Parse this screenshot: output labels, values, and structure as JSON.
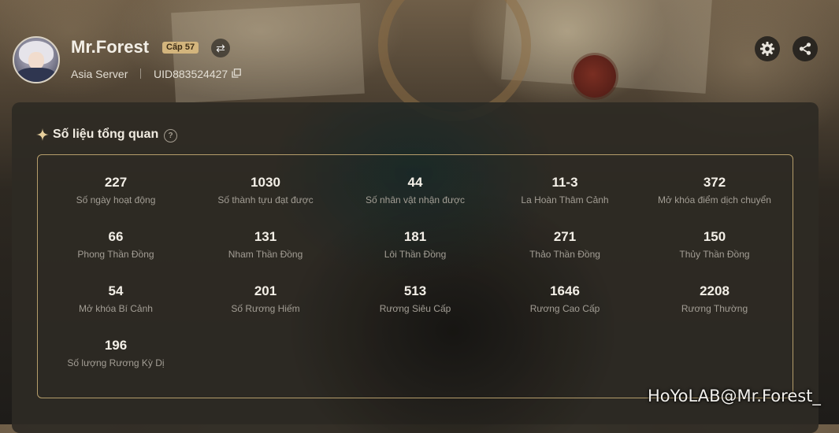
{
  "profile": {
    "name": "Mr.Forest",
    "level_badge": "Cấp 57",
    "server": "Asia Server",
    "uid": "UID883524427"
  },
  "overview": {
    "title": "Số liệu tổng quan",
    "stats": [
      {
        "value": "227",
        "label": "Số ngày hoạt động"
      },
      {
        "value": "1030",
        "label": "Số thành tựu đạt được"
      },
      {
        "value": "44",
        "label": "Số nhân vật nhận được"
      },
      {
        "value": "11-3",
        "label": "La Hoàn Thâm Cảnh"
      },
      {
        "value": "372",
        "label": "Mở khóa điểm dịch chuyển"
      },
      {
        "value": "66",
        "label": "Phong Thần Đồng"
      },
      {
        "value": "131",
        "label": "Nham Thần Đồng"
      },
      {
        "value": "181",
        "label": "Lôi Thần Đồng"
      },
      {
        "value": "271",
        "label": "Thảo Thần Đồng"
      },
      {
        "value": "150",
        "label": "Thủy Thần Đồng"
      },
      {
        "value": "54",
        "label": "Mở khóa Bí Cảnh"
      },
      {
        "value": "201",
        "label": "Số Rương Hiếm"
      },
      {
        "value": "513",
        "label": "Rương Siêu Cấp"
      },
      {
        "value": "1646",
        "label": "Rương Cao Cấp"
      },
      {
        "value": "2208",
        "label": "Rương Thường"
      },
      {
        "value": "196",
        "label": "Số lượng Rương Kỳ Dị"
      }
    ]
  },
  "watermark": "HoYoLAB@Mr.Forest_",
  "icons": {
    "swap": "swap-icon",
    "copy": "copy-icon",
    "settings": "gear-icon",
    "share": "share-icon",
    "title_mark": "sparkle-icon",
    "help": "help-icon"
  },
  "colors": {
    "accent_gold": "#d3b57d",
    "border_gold": "#b59d6b"
  }
}
